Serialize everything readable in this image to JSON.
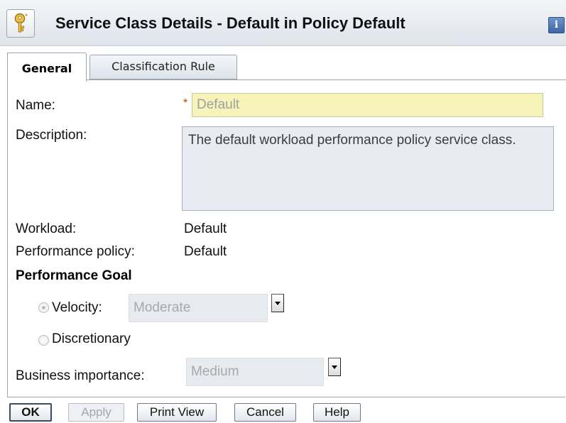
{
  "header": {
    "title": "Service Class Details - Default in Policy Default",
    "icon": "key-icon",
    "info_label": "i"
  },
  "tabs": [
    {
      "label": "General",
      "selected": true
    },
    {
      "label": "Classification Rule",
      "selected": false
    }
  ],
  "form": {
    "name_label": "Name:",
    "required_mark": "*",
    "name_value": "Default",
    "description_label": "Description:",
    "description_value": "The default workload performance policy service class.",
    "workload_label": "Workload:",
    "workload_value": "Default",
    "performance_policy_label": "Performance policy:",
    "performance_policy_value": "Default",
    "performance_goal_title": "Performance Goal",
    "velocity_label": "Velocity:",
    "velocity_value": "Moderate",
    "velocity_selected": true,
    "discretionary_label": "Discretionary",
    "business_importance_label": "Business importance:",
    "business_importance_value": "Medium"
  },
  "buttons": {
    "ok": "OK",
    "apply": "Apply",
    "print_view": "Print View",
    "cancel": "Cancel",
    "help": "Help"
  },
  "colors": {
    "name_field_bg": "#f6f4b9",
    "disabled_field_bg": "#e7eaef",
    "required_mark": "#b54a00",
    "info_button": "#3e66a8"
  }
}
